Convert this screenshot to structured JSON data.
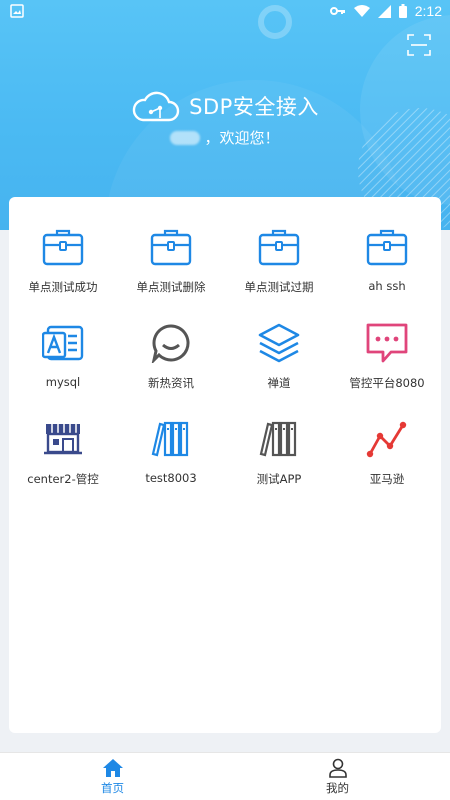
{
  "status_bar": {
    "time": "2:12"
  },
  "header": {
    "brand_title": "SDP安全接入",
    "welcome_text": "，欢迎您！"
  },
  "apps": [
    {
      "label": "单点测试成功",
      "icon": "briefcase-icon"
    },
    {
      "label": "单点测试删除",
      "icon": "briefcase-icon"
    },
    {
      "label": "单点测试过期",
      "icon": "briefcase-icon"
    },
    {
      "label": "ah ssh",
      "icon": "briefcase-icon"
    },
    {
      "label": "mysql",
      "icon": "id-card-icon"
    },
    {
      "label": "新热资讯",
      "icon": "chat-smile-icon"
    },
    {
      "label": "禅道",
      "icon": "layers-icon"
    },
    {
      "label": "管控平台8080",
      "icon": "message-dots-icon"
    },
    {
      "label": "center2-管控",
      "icon": "storefront-icon"
    },
    {
      "label": "test8003",
      "icon": "books-icon"
    },
    {
      "label": "测试APP",
      "icon": "books-gray-icon"
    },
    {
      "label": "亚马逊",
      "icon": "line-chart-icon"
    }
  ],
  "tabbar": {
    "home_label": "首页",
    "profile_label": "我的"
  },
  "colors": {
    "header_blue": "#4bbaf3",
    "icon_blue": "#1e88e5",
    "icon_gray": "#555555",
    "icon_pink": "#e0457b",
    "icon_red": "#e53935",
    "icon_navy": "#3a4a8c"
  }
}
